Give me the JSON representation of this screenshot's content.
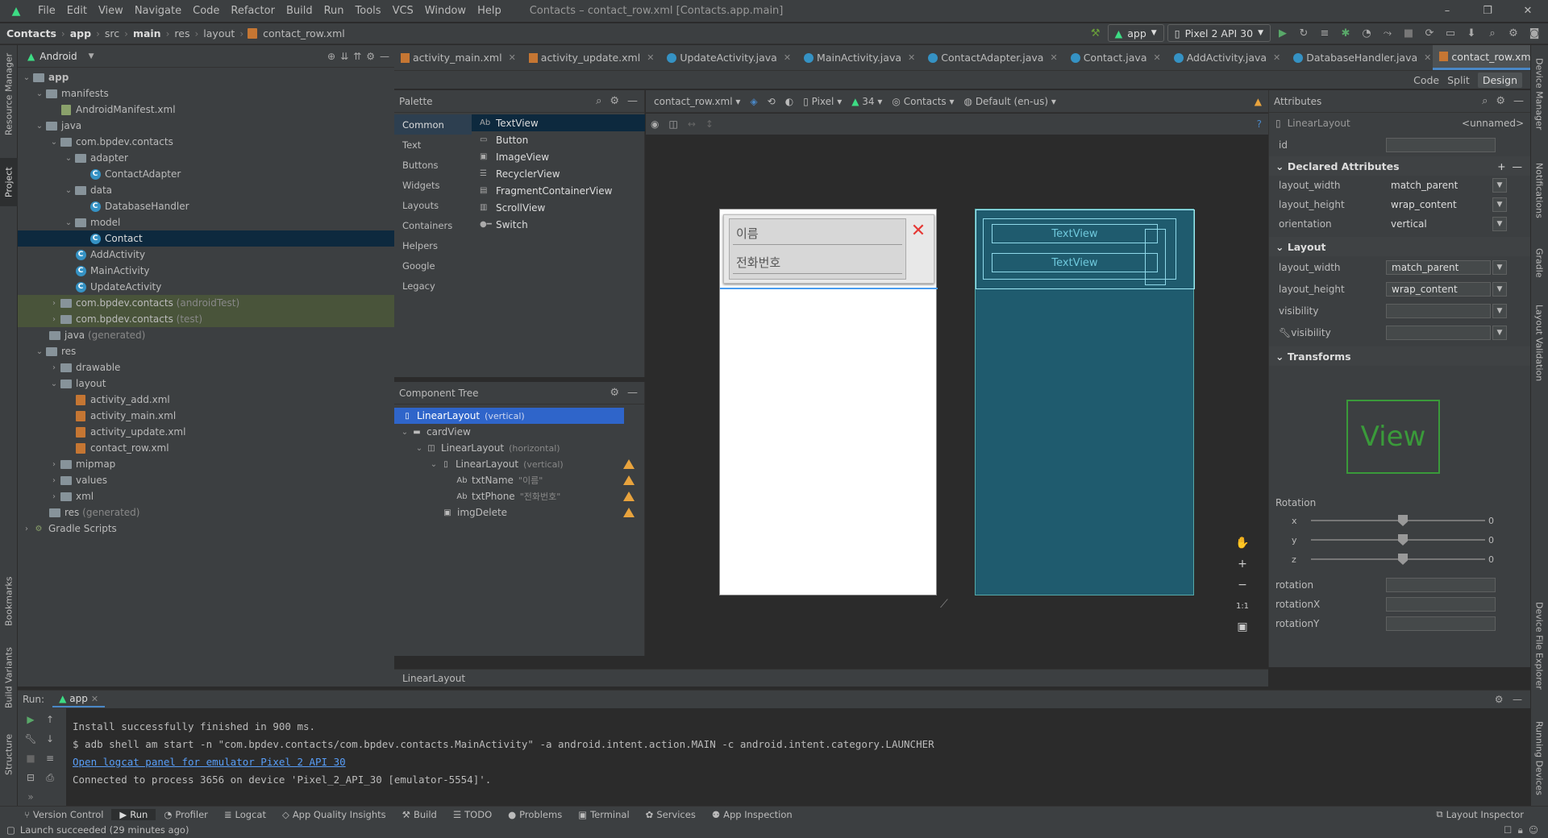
{
  "menubar": {
    "items": [
      "File",
      "Edit",
      "View",
      "Navigate",
      "Code",
      "Refactor",
      "Build",
      "Run",
      "Tools",
      "VCS",
      "Window",
      "Help"
    ],
    "title": "Contacts – contact_row.xml [Contacts.app.main]"
  },
  "breadcrumb": [
    "Contacts",
    "app",
    "src",
    "main",
    "res",
    "layout",
    "contact_row.xml"
  ],
  "toolbar": {
    "run_config": "app",
    "device": "Pixel 2 API 30"
  },
  "project": {
    "view_mode": "Android",
    "tree": [
      {
        "label": "app",
        "bold": true
      },
      {
        "label": "manifests"
      },
      {
        "label": "AndroidManifest.xml"
      },
      {
        "label": "java"
      },
      {
        "label": "com.bpdev.contacts"
      },
      {
        "label": "adapter"
      },
      {
        "label": "ContactAdapter"
      },
      {
        "label": "data"
      },
      {
        "label": "DatabaseHandler"
      },
      {
        "label": "model"
      },
      {
        "label": "Contact"
      },
      {
        "label": "AddActivity"
      },
      {
        "label": "MainActivity"
      },
      {
        "label": "UpdateActivity"
      },
      {
        "label": "com.bpdev.contacts",
        "hint": "(androidTest)"
      },
      {
        "label": "com.bpdev.contacts",
        "hint": "(test)"
      },
      {
        "label": "java",
        "hint": "(generated)"
      },
      {
        "label": "res"
      },
      {
        "label": "drawable"
      },
      {
        "label": "layout"
      },
      {
        "label": "activity_add.xml"
      },
      {
        "label": "activity_main.xml"
      },
      {
        "label": "activity_update.xml"
      },
      {
        "label": "contact_row.xml"
      },
      {
        "label": "mipmap"
      },
      {
        "label": "values"
      },
      {
        "label": "xml"
      },
      {
        "label": "res",
        "hint": "(generated)"
      },
      {
        "label": "Gradle Scripts"
      }
    ]
  },
  "tabs": [
    "activity_main.xml",
    "activity_update.xml",
    "UpdateActivity.java",
    "MainActivity.java",
    "ContactAdapter.java",
    "Contact.java",
    "AddActivity.java",
    "DatabaseHandler.java",
    "contact_row.xml"
  ],
  "modes": [
    "Code",
    "Split",
    "Design"
  ],
  "palette": {
    "title": "Palette",
    "categories": [
      "Common",
      "Text",
      "Buttons",
      "Widgets",
      "Layouts",
      "Containers",
      "Helpers",
      "Google",
      "Legacy"
    ],
    "items": [
      "TextView",
      "Button",
      "ImageView",
      "RecyclerView",
      "FragmentContainerView",
      "ScrollView",
      "Switch"
    ]
  },
  "component_tree": {
    "title": "Component Tree",
    "rows": [
      {
        "label": "LinearLayout",
        "hint": "(vertical)"
      },
      {
        "label": "cardView",
        "hint": ""
      },
      {
        "label": "LinearLayout",
        "hint": "(horizontal)"
      },
      {
        "label": "LinearLayout",
        "hint": "(vertical)"
      },
      {
        "label": "txtName",
        "hint": "\"이름\""
      },
      {
        "label": "txtPhone",
        "hint": "\"전화번호\""
      },
      {
        "label": "imgDelete",
        "hint": ""
      }
    ]
  },
  "design_toolbar": {
    "file": "contact_row.xml",
    "device": "Pixel",
    "api": "34",
    "theme": "Contacts",
    "locale": "Default (en-us)"
  },
  "preview": {
    "name": "이름",
    "phone": "전화번호",
    "blueprint_label": "TextView"
  },
  "design_status": "LinearLayout",
  "attributes": {
    "title": "Attributes",
    "component": "LinearLayout",
    "unnamed": "<unnamed>",
    "id_label": "id",
    "declared_title": "Declared Attributes",
    "declared": [
      {
        "k": "layout_width",
        "v": "match_parent"
      },
      {
        "k": "layout_height",
        "v": "wrap_content"
      },
      {
        "k": "orientation",
        "v": "vertical"
      }
    ],
    "layout_title": "Layout",
    "layout": [
      {
        "k": "layout_width",
        "v": "match_parent"
      },
      {
        "k": "layout_height",
        "v": "wrap_content"
      },
      {
        "k": "visibility",
        "v": ""
      },
      {
        "k": "visibility",
        "v": ""
      }
    ],
    "transforms_title": "Transforms",
    "view_label": "View",
    "rotation_label": "Rotation",
    "rotation_axes": [
      {
        "k": "x",
        "v": "0"
      },
      {
        "k": "y",
        "v": "0"
      },
      {
        "k": "z",
        "v": "0"
      }
    ],
    "rot_fields": [
      "rotation",
      "rotationX",
      "rotationY"
    ]
  },
  "run": {
    "label": "Run:",
    "tab": "app",
    "lines": [
      "Install successfully finished in 900 ms.",
      "$ adb shell am start -n \"com.bpdev.contacts/com.bpdev.contacts.MainActivity\" -a android.intent.action.MAIN -c android.intent.category.LAUNCHER",
      "Open logcat panel for emulator Pixel 2 API 30",
      "Connected to process 3656 on device 'Pixel_2_API_30 [emulator-5554]'."
    ]
  },
  "bottom_tabs": [
    "Version Control",
    "Run",
    "Profiler",
    "Logcat",
    "App Quality Insights",
    "Build",
    "TODO",
    "Problems",
    "Terminal",
    "Services",
    "App Inspection"
  ],
  "layout_inspector": "Layout Inspector",
  "status": "Launch succeeded (29 minutes ago)",
  "left_strip": [
    "Resource Manager",
    "Project",
    "Bookmarks",
    "Build Variants",
    "Structure"
  ],
  "right_strip": [
    "Device Manager",
    "Notifications",
    "Gradle",
    "Layout Validation",
    "Device File Explorer",
    "Running Devices"
  ]
}
